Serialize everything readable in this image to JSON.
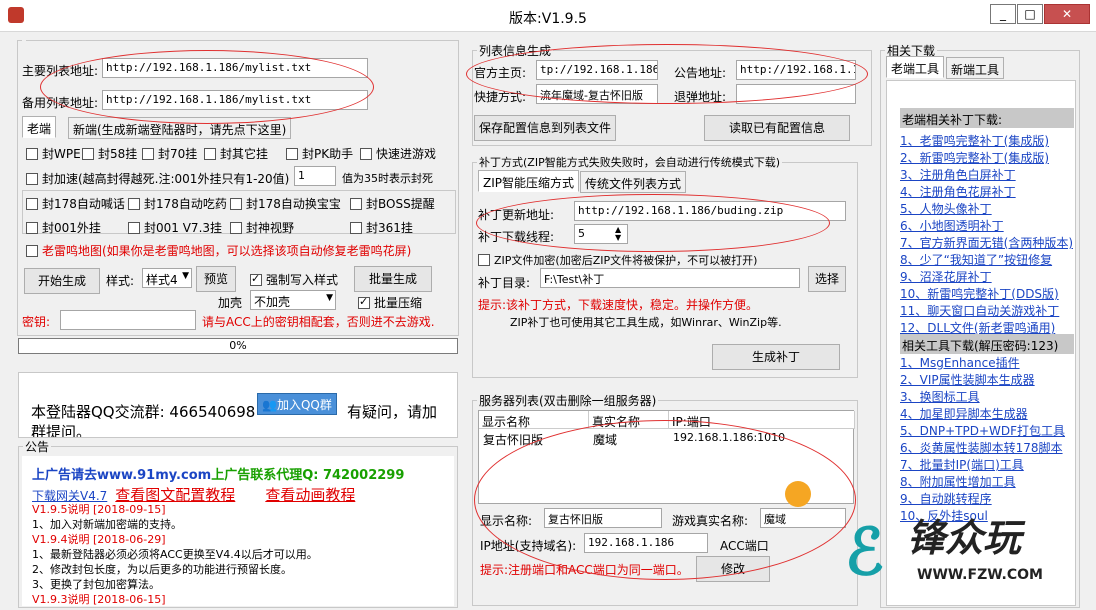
{
  "window": {
    "title": "版本:V1.9.5",
    "min": "_",
    "max": "□",
    "close": "✕"
  },
  "left": {
    "main_list_label": "主要列表地址:",
    "main_list_value": "http://192.168.1.186/mylist.txt",
    "backup_list_label": "备用列表地址:",
    "backup_list_value": "http://192.168.1.186/mylist.txt",
    "tab_old": "老端",
    "tab_new": "新端(生成新端登陆器时，请先点下这里)",
    "checks": [
      "封WPE",
      "封58挂",
      "封70挂",
      "封其它挂",
      "封PK助手",
      "快速进游戏"
    ],
    "speed_check": "封加速(越高封得越死.注:001外挂只有1-20值)",
    "speed_value": "1",
    "speed_note": "值为35时表示封死",
    "checks_row2": [
      "封178自动喊话",
      "封178自动吃药",
      "封178自动换宝宝",
      "封BOSS提醒"
    ],
    "checks_row3": [
      "封001外挂",
      "封001 V7.3挂",
      "封神视野",
      "封361挂"
    ],
    "map_check": "老雷鸣地图(如果你是老雷鸣地图，可以选择该项自动修复老雷鸣花屏)",
    "start_btn": "开始生成",
    "style_label": "样式:",
    "style_value": "样式4",
    "preview_btn": "预览",
    "force_write": "强制写入样式",
    "batch_btn": "批量生成",
    "shell_label": "加壳",
    "shell_value": "不加壳",
    "batch_compress": "批量压缩",
    "key_label": "密钥:",
    "key_note": "请与ACC上的密钥相配套，否则进不去游戏.",
    "progress": "0%",
    "qq_text": "本登陆器QQ交流群:  466540698",
    "qq_btn": "加入QQ群",
    "qq_tail": "有疑问，请加",
    "qq_tail2": "群提问。"
  },
  "notice": {
    "title": "公告",
    "ad_blue": "上广告请去www.91my.com",
    "ad_green": "上广告联系代理Q: 742002299",
    "dl_link": "下载网关V4.7",
    "tut1": "查看图文配置教程",
    "tut2": "查看动画教程",
    "lines": [
      {
        "t": "V1.9.5说明 [2018-09-15]",
        "c": "red"
      },
      {
        "t": "1、加入对新端加密端的支持。",
        "c": "black"
      },
      {
        "t": "V1.9.4说明 [2018-06-29]",
        "c": "red"
      },
      {
        "t": "1、最新登陆器必须必须将ACC更换至V4.4以后才可以用。",
        "c": "black"
      },
      {
        "t": "2、修改封包长度，为以后更多的功能进行预留长度。",
        "c": "black"
      },
      {
        "t": "3、更换了封包加密算法。",
        "c": "black"
      },
      {
        "t": "V1.9.3说明 [2018-06-15]",
        "c": "red"
      }
    ]
  },
  "listinfo": {
    "title": "列表信息生成",
    "home_label": "官方主页:",
    "home_value": "tp://192.168.1.186/",
    "notice_label": "公告地址:",
    "notice_value": "http://192.168.1.186",
    "shortcut_label": "快捷方式:",
    "shortcut_value": "流年魔域-复古怀旧版",
    "exit_label": "退弹地址:",
    "exit_value": "",
    "save_btn": "保存配置信息到列表文件",
    "read_btn": "读取已有配置信息"
  },
  "patch": {
    "title": "补丁方式(ZIP智能方式失败失败时，会自动进行传统模式下载)",
    "tab_zip": "ZIP智能压缩方式",
    "tab_trad": "传统文件列表方式",
    "update_label": "补丁更新地址:",
    "update_value": "http://192.168.1.186/buding.zip",
    "threads_label": "补丁下载线程:",
    "threads_value": "5",
    "zip_encrypt": "ZIP文件加密(加密后ZIP文件将被保护，不可以被打开)",
    "dir_label": "补丁目录:",
    "dir_value": "F:\\Test\\补丁",
    "choose_btn": "选择",
    "tip": "提示:该补丁方式，下载速度快，稳定。并操作方便。",
    "tip2": "ZIP补丁也可使用其它工具生成，如Winrar、WinZip等.",
    "gen_btn": "生成补丁"
  },
  "servers": {
    "title": "服务器列表(双击删除一组服务器)",
    "col_display": "显示名称",
    "col_real": "真实名称",
    "col_ip": "IP:端口",
    "rows": [
      {
        "display": "复古怀旧版",
        "real": "魔域",
        "ip": "192.168.1.186:1010"
      }
    ],
    "display_label": "显示名称:",
    "display_value": "复古怀旧版",
    "real_label": "游戏真实名称:",
    "real_value": "魔域",
    "ip_label": "IP地址(支持域名):",
    "ip_value": "192.168.1.186",
    "acc_label": "ACC端口",
    "tip": "提示:注册端口和ACC端口为同一端口。",
    "modify_btn": "修改"
  },
  "side": {
    "title": "相关下载",
    "tab_old": "老端工具",
    "tab_new": "新端工具",
    "head1": "老端相关补丁下载:",
    "items1": [
      "1、老雷鸣完整补丁(集成版)",
      "2、新雷鸣完整补丁(集成版)",
      "3、注册角色白屏补丁",
      "4、注册角色花屏补丁",
      "5、人物头像补丁",
      "6、小地图透明补丁",
      "7、官方新界面无错(含两种版本)",
      "8、少了“我知道了”按钮修复",
      "9、沼泽花屏补丁",
      "10、新雷鸣完整补丁(DDS版)",
      "11、聊天窗口自动关游戏补丁",
      "12、DLL文件(新老雷鸣通用)"
    ],
    "head2": "相关工具下载(解压密码:123)",
    "items2": [
      "1、MsgEnhance插件",
      "2、VIP属性装脚本生成器",
      "3、换图标工具",
      "4、加星即异脚本生成器",
      "5、DNP+TPD+WDF打包工具",
      "6、炎黄属性装脚本转178脚本",
      "7、批量封IP(端口)工具",
      "8、附加属性增加工具",
      "9、自动跳转程序",
      "10、反外挂soul"
    ]
  },
  "watermark": {
    "logo": "锋众玩",
    "url": "WWW.FZW.COM"
  }
}
